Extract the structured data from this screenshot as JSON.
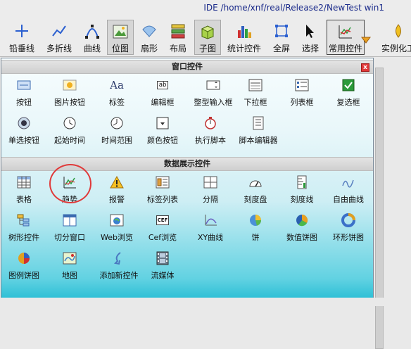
{
  "window": {
    "title": "IDE /home/xnf/real/Release2/NewTest   win1"
  },
  "toolbar": {
    "items": [
      {
        "label": "铅垂线",
        "icon": "vertical-line-icon"
      },
      {
        "label": "多折线",
        "icon": "polyline-icon"
      },
      {
        "label": "曲线",
        "icon": "curve-icon"
      },
      {
        "label": "位图",
        "icon": "bitmap-icon"
      },
      {
        "label": "扇形",
        "icon": "sector-icon"
      },
      {
        "label": "布局",
        "icon": "layout-icon"
      },
      {
        "label": "子图",
        "icon": "subgraph-icon"
      },
      {
        "label": "统计控件",
        "icon": "stats-icon"
      },
      {
        "label": "全屏",
        "icon": "fullscreen-icon"
      },
      {
        "label": "选择",
        "icon": "select-cursor-icon"
      },
      {
        "label": "常用控件",
        "icon": "common-control-icon"
      },
      {
        "label": "实例化工",
        "icon": "instance-icon"
      }
    ]
  },
  "panel": {
    "title": "窗口控件",
    "close_label": "x",
    "window_controls": [
      "按钮",
      "图片按钮",
      "标签",
      "编辑框",
      "整型输入框",
      "下拉框",
      "列表框",
      "复选框",
      "单选按钮",
      "起始时间",
      "时间范围",
      "颜色按钮",
      "执行脚本",
      "脚本编辑器"
    ],
    "data_section_title": "数据展示控件",
    "data_controls": [
      "表格",
      "趋势",
      "报警",
      "标签列表",
      "分隔",
      "刻度盘",
      "刻度线",
      "自由曲线",
      "树形控件",
      "切分窗口",
      "Web浏览",
      "Cef浏览",
      "XY曲线",
      "饼",
      "数值饼图",
      "环形饼图",
      "图例饼图",
      "地图",
      "添加新控件",
      "流媒体"
    ],
    "label_aa": "Aa",
    "label_ab": "ab",
    "label_cef": "CEF",
    "colors": {
      "highlight_circle": "#e03a3a",
      "panel_bottom": "#2fc0d6"
    }
  }
}
